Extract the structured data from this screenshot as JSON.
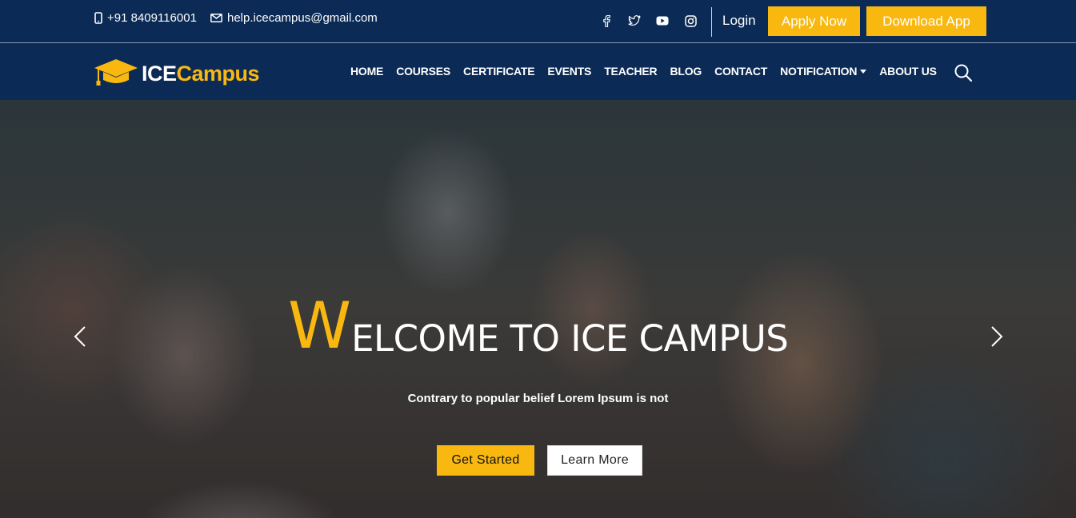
{
  "topbar": {
    "phone": "+91 8409116001",
    "email": "help.icecampus@gmail.com",
    "socials": [
      "facebook-icon",
      "twitter-icon",
      "youtube-icon",
      "instagram-icon"
    ],
    "login_label": "Login",
    "apply_label": "Apply Now",
    "download_label": "Download App"
  },
  "nav": {
    "logo_ice": "ICE",
    "logo_campus": "Campus",
    "items": [
      "HOME",
      "COURSES",
      "CERTIFICATE",
      "EVENTS",
      "TEACHER",
      "BLOG",
      "CONTACT",
      "NOTIFICATION",
      "ABOUT US"
    ]
  },
  "hero": {
    "headline_first": "W",
    "headline_rest": "ELCOME TO ICE CAMPUS",
    "subtitle": "Contrary to popular belief Lorem Ipsum is not",
    "primary_cta": "Get Started",
    "secondary_cta": "Learn More"
  },
  "colors": {
    "navy": "#0b2a55",
    "accent": "#f9b810",
    "white": "#ffffff"
  }
}
